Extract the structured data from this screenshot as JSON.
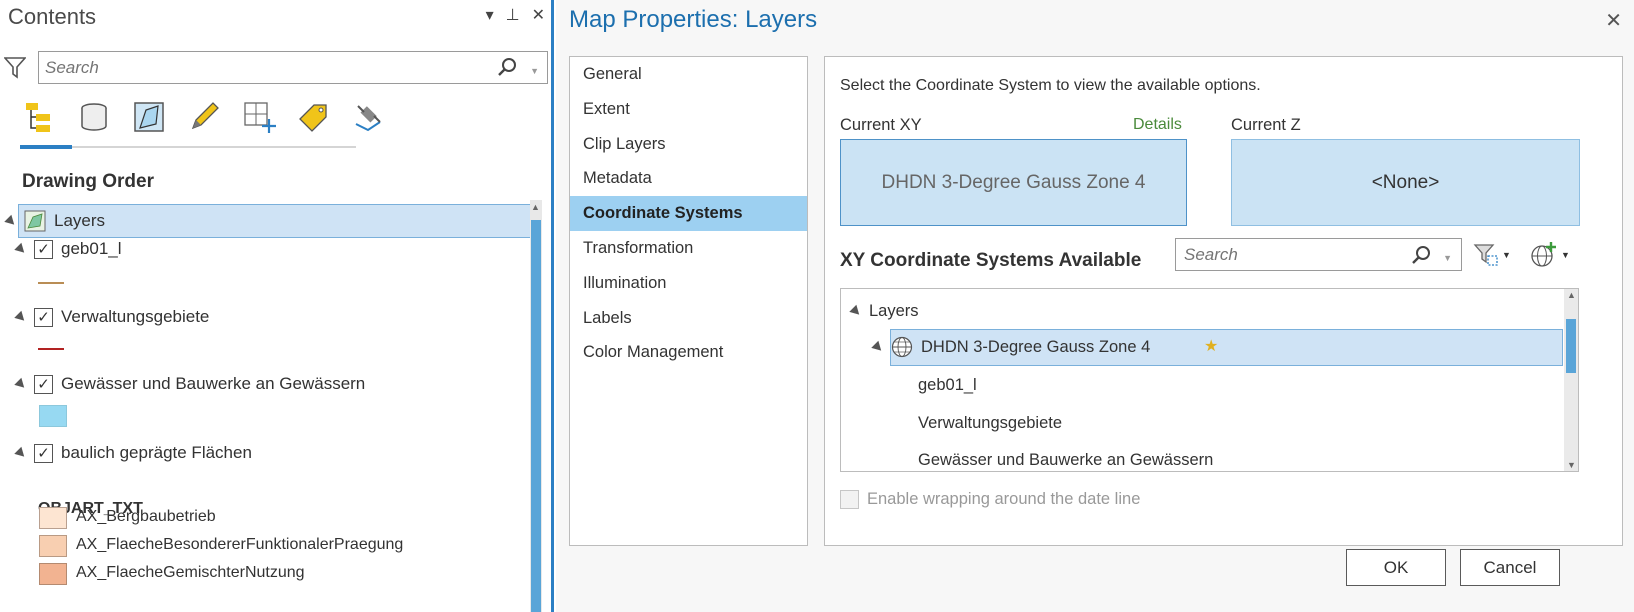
{
  "contents": {
    "title": "Contents",
    "controls": {
      "menu": "▾",
      "pin": "⊥",
      "close": "✕"
    },
    "search_placeholder": "Search",
    "section_title": "Drawing Order",
    "root_layer": "Layers",
    "layers": [
      {
        "name": "geb01_l",
        "checked": "✓",
        "symbol_color": "#b98d55"
      },
      {
        "name": "Verwaltungsgebiete",
        "checked": "✓",
        "symbol_color": "#b22222"
      },
      {
        "name": "Gewässer und Bauwerke an Gewässern",
        "checked": "✓",
        "symbol_color": "#97d9f2"
      },
      {
        "name": "baulich geprägte Flächen",
        "checked": "✓"
      }
    ],
    "field_heading": "OBJART_TXT",
    "symbols": [
      {
        "label": "AX_Bergbaubetrieb",
        "color": "#fde5d2"
      },
      {
        "label": "AX_FlaecheBesondererFunktionalerPraegung",
        "color": "#f8cfb1"
      },
      {
        "label": "AX_FlaecheGemischterNutzung",
        "color": "#f2b391"
      }
    ]
  },
  "dialog": {
    "title": "Map Properties: Layers",
    "close": "✕",
    "nav": [
      "General",
      "Extent",
      "Clip Layers",
      "Metadata",
      "Coordinate Systems",
      "Transformation",
      "Illumination",
      "Labels",
      "Color Management"
    ],
    "hint": "Select the Coordinate System to view the available options.",
    "current_xy_label": "Current XY",
    "details_link": "Details",
    "current_z_label": "Current Z",
    "current_xy_value": "DHDN 3-Degree Gauss Zone 4",
    "current_z_value": "<None>",
    "available_heading": "XY Coordinate Systems Available",
    "search_placeholder": "Search",
    "tree": {
      "root": "Layers",
      "cs": "DHDN 3-Degree Gauss Zone 4",
      "children": [
        "geb01_l",
        "Verwaltungsgebiete",
        "Gewässer und Bauwerke an Gewässern"
      ]
    },
    "wrap_label": "Enable wrapping around the date line",
    "ok_label": "OK",
    "cancel_label": "Cancel"
  },
  "colors": {
    "accent": "#2b7fc4",
    "selection": "#cfe3f5",
    "nav_active": "#9dd0f1",
    "title_blue": "#1c6fae",
    "details_green": "#4a8a3b"
  }
}
